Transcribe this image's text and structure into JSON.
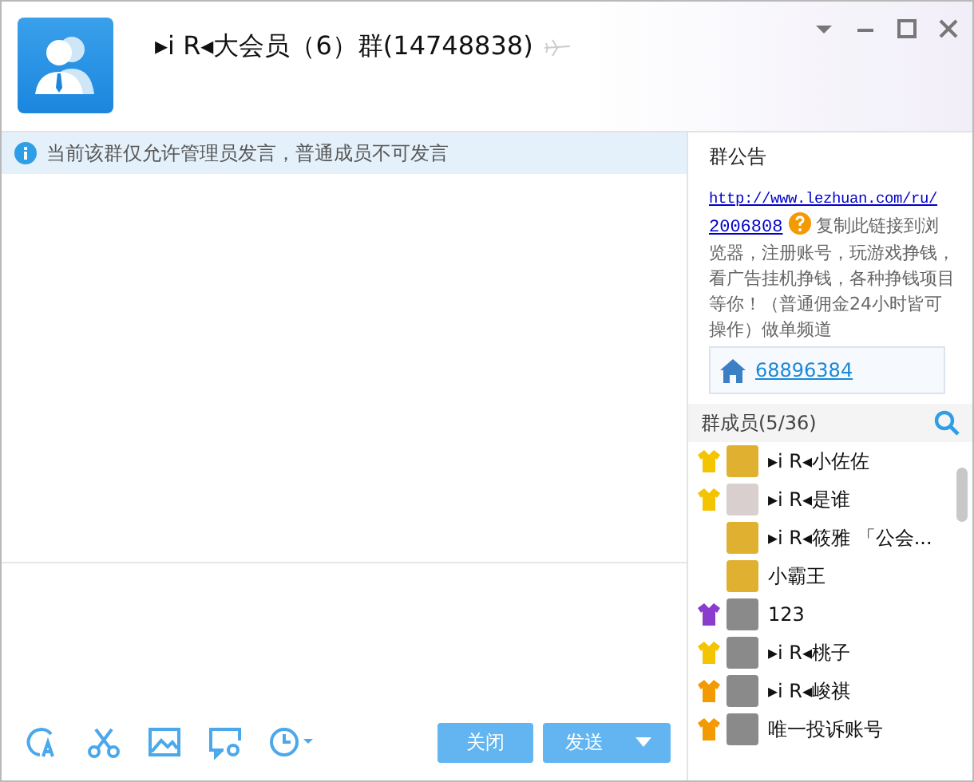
{
  "window": {
    "title": "▸i R◂大会员（6）群(14748838)"
  },
  "notice": {
    "text": "当前该群仅允许管理员发言，普通成员不可发言"
  },
  "announcement": {
    "title": "群公告",
    "link_lines": [
      "http://www.lezhuan.com/ru/",
      "2006808"
    ],
    "text": "复制此链接到浏览器，注册账号，玩游戏挣钱，看广告挂机挣钱，各种挣钱项目等你！（普通佣金24小时皆可操作）做单频道",
    "group_number": "68896384"
  },
  "members": {
    "title": "群成员(5/36)",
    "items": [
      {
        "name": "▸i R◂小佐佐",
        "color": "#f4c400",
        "kind": "cartoon"
      },
      {
        "name": "▸i R◂是谁",
        "color": "#f4c400",
        "kind": "photo"
      },
      {
        "name": "▸i R◂筱雅 「公会...",
        "kind": "cartoon"
      },
      {
        "name": "小霸王",
        "kind": "cartoon"
      },
      {
        "name": "123",
        "color": "#8a3ccc",
        "kind": "gray"
      },
      {
        "name": "▸i R◂桃子",
        "color": "#f4c400",
        "kind": "gray"
      },
      {
        "name": "▸i R◂峻祺",
        "color": "#f39a00",
        "kind": "gray"
      },
      {
        "name": "唯一投诉账号",
        "color": "#f39a00",
        "kind": "gray"
      }
    ]
  },
  "buttons": {
    "close": "关闭",
    "send": "发送"
  }
}
